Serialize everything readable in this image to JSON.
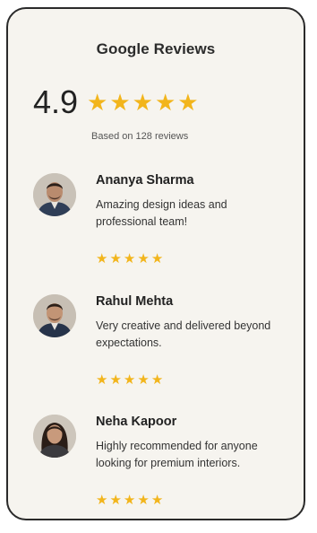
{
  "widget": {
    "title": "Google Reviews",
    "rating": "4.9",
    "rating_stars": 5,
    "based_on": "Based on 128 reviews",
    "star_color": "#f2b51c"
  },
  "reviews": [
    {
      "name": "Ananya Sharma",
      "text": "Amazing design ideas and professional team!",
      "stars": 5
    },
    {
      "name": "Rahul Mehta",
      "text": "Very creative and delivered beyond expectations.",
      "stars": 5
    },
    {
      "name": "Neha Kapoor",
      "text": "Highly recommended for anyone looking for premium interiors.",
      "stars": 5
    }
  ]
}
